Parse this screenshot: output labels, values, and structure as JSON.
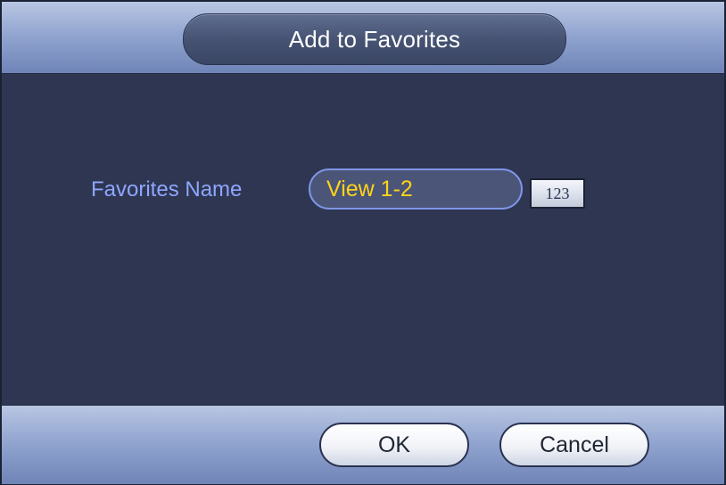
{
  "dialog": {
    "title": "Add to Favorites",
    "favorites_name": {
      "label": "Favorites Name",
      "value": "View 1-2"
    },
    "keyboard_button_label": "123",
    "ok_label": "OK",
    "cancel_label": "Cancel"
  },
  "colors": {
    "background": "#2f3652",
    "label_text": "#8ea6ff",
    "input_text": "#ffd31a"
  }
}
